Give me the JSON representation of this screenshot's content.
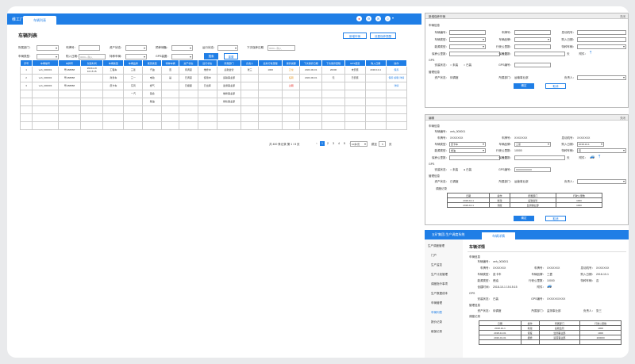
{
  "nav": {
    "brand": "维工厂",
    "tab": "车辆列表",
    "icons": [
      "bell-icon",
      "gear-icon",
      "mail-icon",
      "user-icon"
    ]
  },
  "list": {
    "title": "车辆列表",
    "btn_add": "新增车辆",
    "btn_bulk": "设置保养提醒",
    "filters": {
      "dept": "所属部门：",
      "plate": "车牌号：",
      "asset": "资产状态：",
      "reserve": "预养储备：",
      "op": "运行状态：",
      "next_maint": "下次保养日期",
      "type": "车辆类型：",
      "date": "购入日期：",
      "brand": "特种车辆：",
      "gps": "GPS装置：",
      "date_ph": "0000—购入",
      "next_ph": "0000—购入"
    },
    "search": "搜索",
    "reset": "重置",
    "headers": [
      "序号",
      "车辆编号",
      "车牌号",
      "创建时间",
      "车辆类型",
      "车辆品牌",
      "能源类型",
      "特种车辆",
      "资产状态",
      "运行状态",
      "所属部门",
      "负责人",
      "最新行驶里程",
      "保养提醒",
      "下次保养日期",
      "下次保养里程",
      "GPS装置",
      "购入日期",
      "操作"
    ],
    "rows": [
      [
        "1",
        "veh_000001",
        "粤A88888",
        "2023-2-8\n10:15:15",
        "工程车",
        "三菱",
        "汽油",
        "否",
        "待调度",
        "维修中",
        "后勤监管",
        "张三",
        "1000",
        "正常",
        "2023-06-01",
        "20000",
        "未安装",
        "2018-10-1",
        "保养"
      ],
      [
        "2",
        "veh_000002",
        "粤A88888",
        "",
        "商务车",
        "三一",
        "电动",
        "是",
        "已调度",
        "使用中",
        "运输事业部",
        "",
        "",
        "临期",
        "2023-06-01",
        "无",
        "已安装",
        "",
        "保养 编辑 详情"
      ],
      [
        "3",
        "veh_000003",
        "粤A88888",
        "",
        "皮卡车",
        "东风",
        "燃气",
        "",
        "已报废",
        "已出库",
        "监测事业部",
        "",
        "",
        "过期",
        "",
        "",
        "",
        "",
        "详情"
      ],
      [
        "",
        "",
        "",
        "",
        "",
        "一汽",
        "混合",
        "",
        "",
        "",
        "维修事业部",
        "",
        "",
        "",
        "",
        "",
        "",
        "",
        ""
      ],
      [
        "",
        "",
        "",
        "",
        "",
        "",
        "柴油",
        "",
        "",
        "",
        "绿化事业部",
        "",
        "",
        "",
        "",
        "",
        "",
        "",
        ""
      ],
      [
        "",
        "",
        "",
        "",
        "",
        "",
        "",
        "",
        "",
        "",
        "",
        "",
        "",
        "",
        "",
        "",
        "",
        "",
        ""
      ],
      [
        "",
        "",
        "",
        "",
        "",
        "",
        "",
        "",
        "",
        "",
        "",
        "",
        "",
        "",
        "",
        "",
        "",
        "",
        ""
      ],
      [
        "",
        "",
        "",
        "",
        "",
        "",
        "",
        "",
        "",
        "",
        "",
        "",
        "",
        "",
        "",
        "",
        "",
        "",
        ""
      ]
    ],
    "pager": {
      "total": "共 400 条记录 第 1 / 8 页",
      "pages": [
        "‹",
        "1",
        "2",
        "3",
        "4",
        "5",
        "›"
      ],
      "size": "10条/页",
      "goto": "跳至",
      "goto_val": "5",
      "page": "页"
    }
  },
  "form1": {
    "title": "新增保养车辆",
    "close": "关闭",
    "sec1": "车辆信息",
    "labels": [
      "车辆编号：",
      "车牌号：",
      "发动机号：",
      "车辆类型：",
      "车辆品牌：",
      "购入日期：",
      "能源类型：",
      "行驶公里数：",
      "特种车辆：",
      "保养公里数：",
      "保养天数：",
      "附件："
    ],
    "km": "公里",
    "day": "天",
    "gps": "GPS",
    "gps_lbl": "安装状态：",
    "gps_yes": "未装",
    "gps_no": "已装",
    "gps_num": "GPS编号：",
    "mgmt": "管理信息",
    "asset": "资产状态：",
    "asset_val": "待调度",
    "dept": "所属部门：",
    "dept_val": "运输事业部",
    "owner": "负责人：",
    "ok": "确定",
    "cancel": "取消"
  },
  "form2": {
    "title": "编辑",
    "close": "关闭",
    "sec1": "车辆信息",
    "id_lbl": "车辆编号：",
    "id_val": "veh_000001",
    "plate_lbl": "车牌号：",
    "plate_val": "XXXXXXX",
    "plate2_lbl": "车牌号：",
    "plate2_val": "XXXXXXX",
    "eng_lbl": "发动机号：",
    "eng_val": "XXXXXXX",
    "type_lbl": "车辆类型：",
    "type_val": "皮卡车",
    "brand_lbl": "车辆品牌：",
    "brand_val": "三菱",
    "date_lbl": "购入日期：",
    "date_val": "2018-10-1",
    "energy_lbl": "能源类型：",
    "energy_val": "燃油",
    "mile_lbl": "行驶公里数：",
    "mile_val": "10000",
    "spec_lbl": "特种车辆：",
    "spec_val": "否",
    "mk_lbl": "保养公里数：",
    "mk_unit": "公里",
    "md_lbl": "保养天数：",
    "md_unit": "天",
    "att_lbl": "附件：",
    "gps": "GPS",
    "gps_lbl": "安装状态：",
    "gps_a": "未装",
    "gps_b": "已装",
    "gps_num": "GPS编号：",
    "gps_val": "XXXXXXXXXX",
    "mgmt": "管理信息",
    "asset": "资产状态：",
    "asset_val": "已调度",
    "dept": "所属部门：",
    "dept_val": "运营事业部",
    "owner": "负责人：",
    "rec": "调度记录",
    "rec_h": [
      "日期",
      "操作",
      "所属部门",
      "行驶公里数"
    ],
    "rec_rows": [
      [
        "2018-10-1",
        "新建",
        "后勤监管",
        "1000"
      ],
      [
        "2018-10-1",
        "调度",
        "监测事业部",
        "1000"
      ]
    ],
    "ok": "确定",
    "cancel": "取消"
  },
  "detail": {
    "sys": "五矿集团-生产调度系统",
    "tab": "车辆详情",
    "title": "车辆详情",
    "side": [
      "生产调度管理",
      "门户",
      "生产监控",
      "生产计划管理",
      "调度指令事项",
      "生产数据成本",
      "车辆管理",
      "车辆列表",
      "报价记录",
      "维保记录"
    ],
    "sec1": "车辆信息",
    "id_lbl": "车辆编号：",
    "id_val": "veh_000001",
    "plate_lbl": "车牌号：",
    "plate_val": "XXXXXXX",
    "plate2_lbl": "车牌号：",
    "plate2_val": "XXXXXXX",
    "eng_lbl": "发动机号：",
    "eng_val": "XXXXXXX",
    "type_lbl": "车辆类型：",
    "type_val": "皮卡车",
    "brand_lbl": "车辆品牌：",
    "brand_val": "三菱",
    "date_lbl": "购入日期：",
    "date_val": "2018-10-1",
    "energy_lbl": "能源类型：",
    "energy_val": "燃油",
    "mile_lbl": "行驶公里数：",
    "mile_val": "10000",
    "spec_lbl": "特种车辆：",
    "spec_val": "否",
    "create_lbl": "创建时间：",
    "create_val": "2018-10-1 15:15:15",
    "att_lbl": "附件：",
    "gps": "GPS",
    "gps_lbl": "安装状态：",
    "gps_val": "已装",
    "gps_num": "GPS编号：",
    "gps_num_val": "XXXXXXXXXX",
    "mgmt": "管理信息",
    "asset": "资产状态：",
    "asset_val": "待调度",
    "dept": "所属部门：",
    "dept_val": "监测事业部",
    "owner": "负责人：",
    "owner_val": "张三",
    "rec": "调度记录",
    "rec_h": [
      "日期",
      "操作",
      "所属部门",
      "行驶公里数"
    ],
    "rec_rows": [
      [
        "2018-10-1",
        "新建",
        "后勤监管",
        "1000"
      ],
      [
        "2018-10-01",
        "调度",
        "监测事业部",
        "1000"
      ],
      [
        "2020-01-01",
        "报修",
        "运营事业部",
        "200000"
      ],
      [
        "",
        "",
        "",
        ""
      ]
    ]
  }
}
